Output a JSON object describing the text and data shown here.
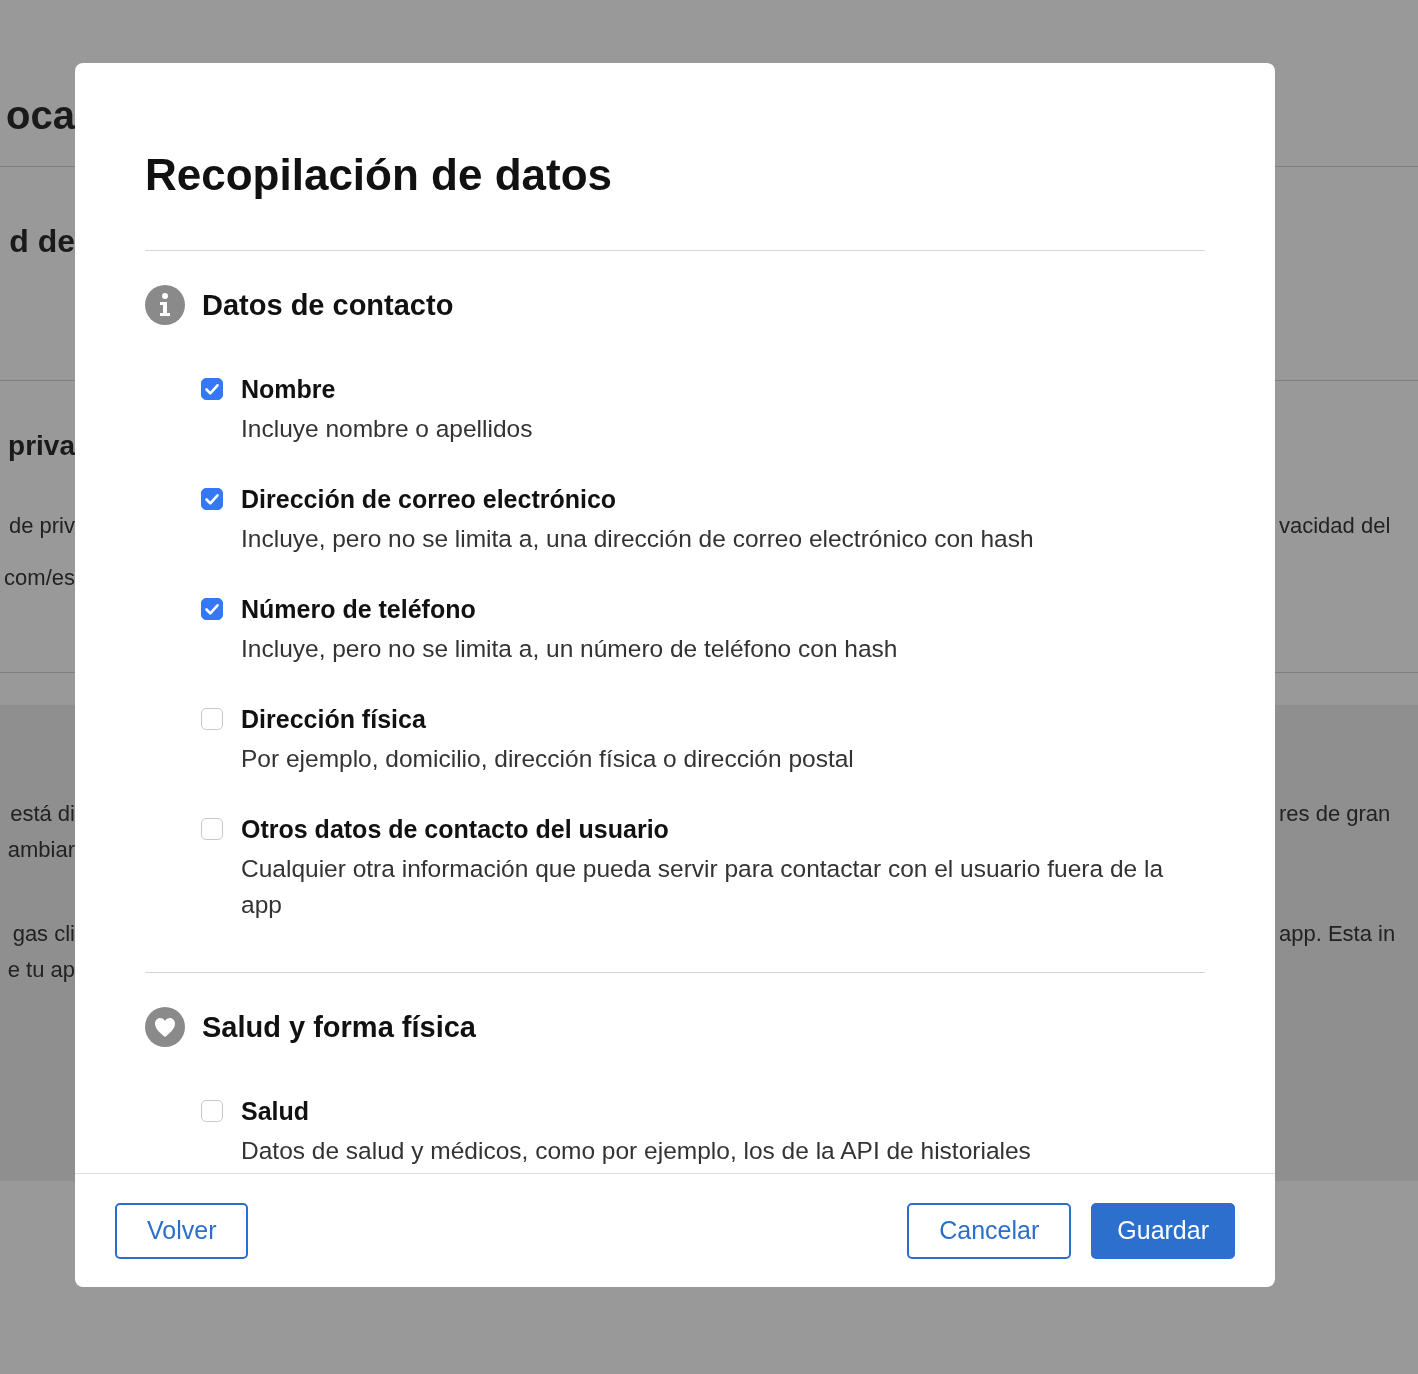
{
  "background": {
    "sections": [
      {
        "blocks": [
          [
            {
              "kind": "hero",
              "left": "oca"
            }
          ]
        ]
      },
      {
        "blocks": [
          [
            {
              "kind": "title",
              "left": "d de"
            }
          ]
        ]
      },
      {
        "blocks": [
          [
            {
              "kind": "subtitle",
              "left": "priva"
            }
          ],
          [
            {
              "kind": "text",
              "left": "de priv",
              "right": "vacidad del"
            }
          ],
          [
            {
              "kind": "text",
              "left": "com/es"
            }
          ]
        ]
      },
      {
        "blocks": [
          [
            {
              "kind": "text",
              "left": "está di",
              "right": "res de gran"
            },
            {
              "kind": "text",
              "left": "ambiar"
            }
          ],
          [
            {
              "kind": "text",
              "left": "gas cli",
              "right": "app. Esta in"
            },
            {
              "kind": "text",
              "left": "e tu ap"
            }
          ]
        ]
      }
    ]
  },
  "dialog": {
    "title": "Recopilación de datos",
    "sections": [
      {
        "title": "Datos de contacto",
        "items": [
          {
            "label": "Nombre",
            "description": "Incluye nombre o apellidos",
            "checked": true
          },
          {
            "label": "Dirección de correo electrónico",
            "description": "Incluye, pero no se limita a, una dirección de correo electrónico con hash",
            "checked": true
          },
          {
            "label": "Número de teléfono",
            "description": "Incluye, pero no se limita a, un número de teléfono con hash",
            "checked": true
          },
          {
            "label": "Dirección física",
            "description": "Por ejemplo, domicilio, dirección física o dirección postal",
            "checked": false
          },
          {
            "label": "Otros datos de contacto del usuario",
            "description": "Cualquier otra información que pueda servir para contactar con el usuario fuera de la app",
            "checked": false
          }
        ]
      },
      {
        "title": "Salud y forma física",
        "items": [
          {
            "label": "Salud",
            "description": "Datos de salud y médicos, como por ejemplo, los de la API de historiales",
            "checked": false
          }
        ]
      }
    ],
    "buttons": [
      {
        "label": "Volver",
        "kind": "secondary"
      },
      {
        "label": "Cancelar",
        "kind": "secondary"
      },
      {
        "label": "Guardar",
        "kind": "primary"
      }
    ]
  }
}
